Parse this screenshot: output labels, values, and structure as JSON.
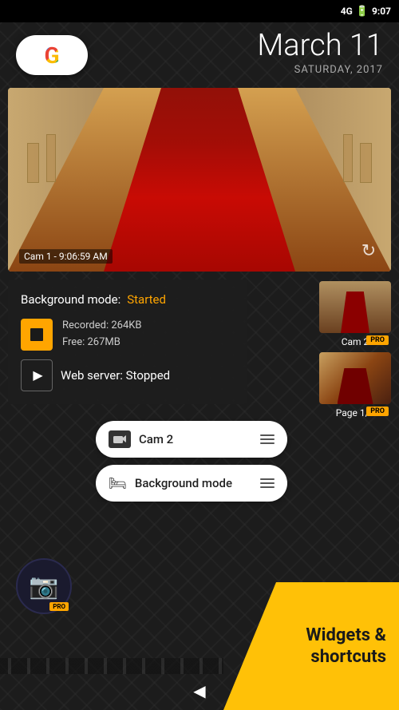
{
  "statusBar": {
    "signal": "4G",
    "time": "9:07"
  },
  "dateWidget": {
    "date": "March 11",
    "dayYear": "SATURDAY, 2017"
  },
  "googleWidget": {
    "letter": "G"
  },
  "cameraFeed": {
    "label": "Cam 1 - 9:06:59 AM"
  },
  "mainPanel": {
    "bgModeLabel": "Background mode:",
    "bgModeStatus": "Started",
    "recordedLabel": "Recorded: 264KB",
    "freeLabel": "Free: 267MB",
    "webServerLabel": "Web server: Stopped"
  },
  "cam2Dropdown": {
    "label": "Cam 2"
  },
  "bgDropdown": {
    "label": "Background mode"
  },
  "thumbnails": [
    {
      "label": "Cam 2",
      "pro": "PRO"
    },
    {
      "label": "Page 1/2",
      "pro": "PRO"
    }
  ],
  "widgetsBanner": {
    "line1": "Widgets &",
    "line2": "shortcuts"
  },
  "backButton": "◀"
}
